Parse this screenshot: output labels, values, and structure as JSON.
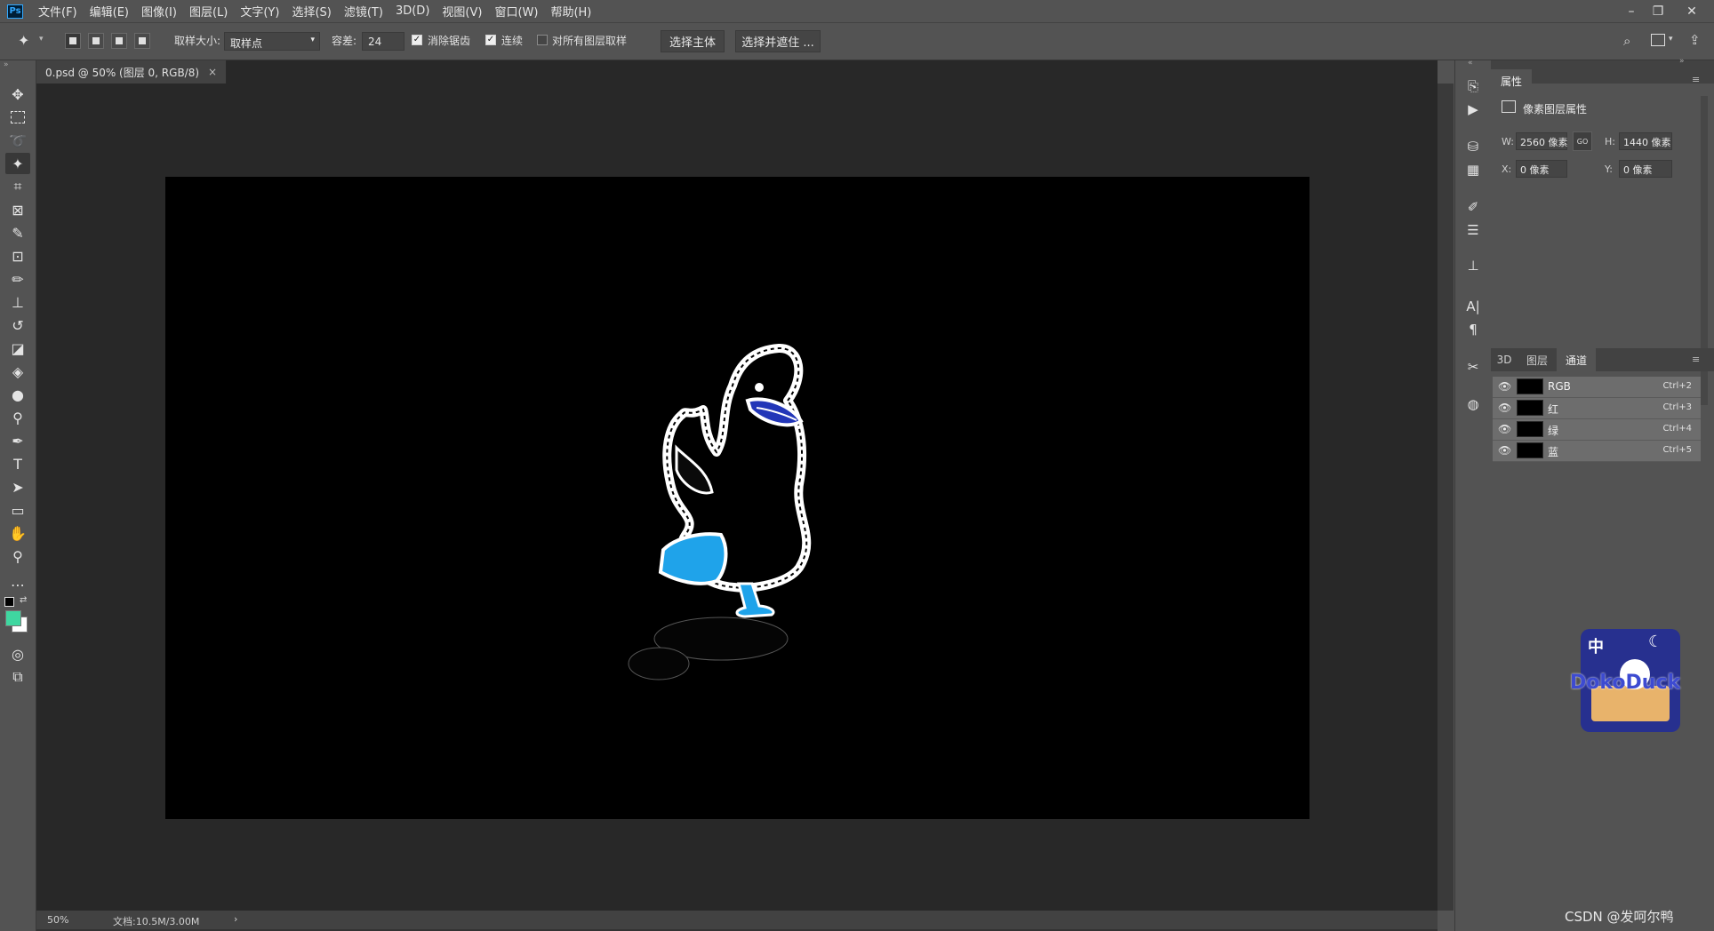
{
  "app": {
    "logo": "Ps"
  },
  "menu": [
    "文件(F)",
    "编辑(E)",
    "图像(I)",
    "图层(L)",
    "文字(Y)",
    "选择(S)",
    "滤镜(T)",
    "3D(D)",
    "视图(V)",
    "窗口(W)",
    "帮助(H)"
  ],
  "window_controls": {
    "minimize": "–",
    "restore": "❐",
    "close": "✕"
  },
  "options": {
    "sample_size_label": "取样大小:",
    "sample_size_value": "取样点",
    "tolerance_label": "容差:",
    "tolerance_value": "24",
    "antialias_label": "消除锯齿",
    "antialias_checked": true,
    "contiguous_label": "连续",
    "contiguous_checked": true,
    "sample_all_label": "对所有图层取样",
    "sample_all_checked": false,
    "select_subject": "选择主体",
    "select_mask": "选择并遮住 ..."
  },
  "document": {
    "tab_title": "0.psd @ 50% (图层 0, RGB/8)",
    "tab_close": "×",
    "zoom": "50%",
    "doc_size": "文档:10.5M/3.00M",
    "status_arrow": "›"
  },
  "properties_panel": {
    "title": "属性",
    "subtitle": "像素图层属性",
    "w_label": "W:",
    "w_value": "2560 像素",
    "h_label": "H:",
    "h_value": "1440 像素",
    "x_label": "X:",
    "x_value": "0 像素",
    "y_label": "Y:",
    "y_value": "0 像素",
    "link_label": "GO"
  },
  "layers_panel": {
    "tabs": [
      "3D",
      "图层",
      "通道"
    ],
    "active_tab": "通道",
    "channels": [
      {
        "name": "RGB",
        "shortcut": "Ctrl+2"
      },
      {
        "name": "红",
        "shortcut": "Ctrl+3"
      },
      {
        "name": "绿",
        "shortcut": "Ctrl+4"
      },
      {
        "name": "蓝",
        "shortcut": "Ctrl+5"
      }
    ]
  },
  "watermark": {
    "text": "CSDN @发呵尔鸭",
    "sticker_badge": "中",
    "sticker_text": "DokoDuck"
  },
  "colors": {
    "foreground": "#3fd7a0",
    "background": "#ffffff",
    "accent_blue": "#1fa3ea"
  }
}
